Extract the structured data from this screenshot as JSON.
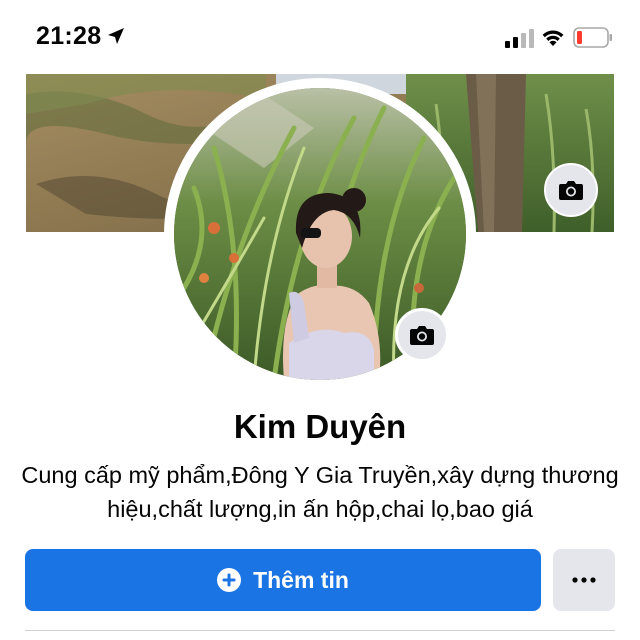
{
  "status_bar": {
    "time": "21:28",
    "icons": [
      "location-arrow-icon",
      "cellular-signal-icon",
      "wifi-icon",
      "battery-low-icon"
    ],
    "battery_color": "#ff3b30"
  },
  "profile": {
    "name": "Kim Duyên",
    "bio": "Cung cấp mỹ phẩm,Đông Y Gia Truyền,xây dựng thương hiệu,chất lượng,in ấn hộp,chai lọ,bao giá"
  },
  "actions": {
    "add_info_label": "Thêm tin",
    "add_info_icon": "plus-circle-icon",
    "more_icon": "more-horizontal-icon"
  },
  "colors": {
    "primary": "#1b74e4",
    "secondary_button": "#e4e6eb",
    "text": "#050505"
  }
}
